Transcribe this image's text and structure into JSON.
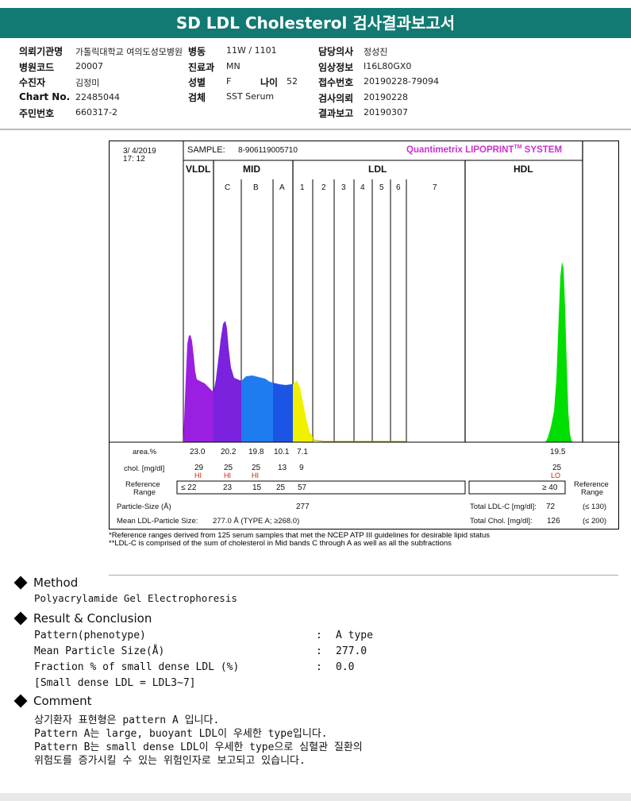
{
  "title": "SD LDL Cholesterol 검사결과보고서",
  "info": {
    "r1": {
      "l1": "의뢰기관명",
      "v1": "가톨릭대학교 여의도성모병원",
      "l2": "병동",
      "v2": "11W / 1101",
      "l3": "담당의사",
      "v3": "정성진"
    },
    "r2": {
      "l1": "병원코드",
      "v1": "20007",
      "l2": "진료과",
      "v2": "MN",
      "l3": "임상정보",
      "v3": "I16L80GX0"
    },
    "r3": {
      "l1": "수진자",
      "v1": "김정미",
      "l2": "성별",
      "v2": "F",
      "l2b": "나이",
      "v2b": "52",
      "l3": "접수번호",
      "v3": "20190228-79094"
    },
    "r4": {
      "l1": "Chart No.",
      "v1": "22485044",
      "l2": "검체",
      "v2": "SST Serum",
      "l3": "검사의뢰",
      "v3": "20190228"
    },
    "r5": {
      "l1": "주민번호",
      "v1": "660317-2",
      "l3": "결과보고",
      "v3": "20190307"
    }
  },
  "report": {
    "date": "3/  4/2019",
    "time": "17: 12",
    "sample_label": "SAMPLE:",
    "sample_id": "8-906119005710",
    "system_name": "Quantimetrix LIPOPRINT",
    "system_tm": "TM",
    "system_suffix": " SYSTEM",
    "accent_color": "#cc33cc",
    "groups": {
      "vldl": "VLDL",
      "mid": "MID",
      "ldl": "LDL",
      "hdl": "HDL"
    },
    "mid_bands": [
      "C",
      "B",
      "A"
    ],
    "ldl_bands": [
      "1",
      "2",
      "3",
      "4",
      "5",
      "6",
      "7"
    ],
    "area_label": "area.%",
    "area_values": {
      "vldl": "23.0",
      "c": "20.2",
      "b": "19.8",
      "a": "10.1",
      "l1": "7.1",
      "hdl": "19.5"
    },
    "chol_label": "chol. [mg/dl]",
    "chol_values": {
      "vldl": "29",
      "c": "25",
      "b": "25",
      "a": "13",
      "l1": "9",
      "hdl": "25"
    },
    "flags": {
      "vldl": "HI",
      "c": "HI",
      "b": "HI",
      "hdl": "LO"
    },
    "ref_label_1": "Reference",
    "ref_label_2": "Range",
    "ref_values": {
      "vldl": "≤  22",
      "c": "23",
      "b": "15",
      "a": "25",
      "l1": "57",
      "hdl": "≥ 40"
    },
    "particle_size_label": "Particle-Size (Å)",
    "particle_size_value": "277",
    "mean_ldl_label": "Mean LDL-Particle Size:",
    "mean_ldl_value": "277.0 Å   (TYPE A; ≥268.0)",
    "total_ldl_label": "Total LDL-C [mg/dl]:",
    "total_ldl_value": "72",
    "total_ldl_ref": "(≤ 130)",
    "total_chol_label": "Total Chol. [mg/dl]:",
    "total_chol_value": "126",
    "total_chol_ref": "(≤ 200)",
    "colors": {
      "vldl": "#9b1fe0",
      "c": "#7a22dd",
      "b": "#1f7bf0",
      "a": "#1c55e6",
      "l1": "#f0f000",
      "hdl": "#00dd00",
      "flag": "#cc2200"
    }
  },
  "footnotes": [
    "*Reference ranges derived from 125 serum samples that met the NCEP ATP III guidelines for desirable lipid status",
    "**LDL-C is comprised of the sum of cholesterol in Mid bands C through A as well as all the subfractions"
  ],
  "method": {
    "heading": "Method",
    "text": "Polyacrylamide Gel Electrophoresis"
  },
  "result": {
    "heading": "Result & Conclusion",
    "rows": [
      {
        "label": "Pattern(phenotype)",
        "sep": ":",
        "value": "A type"
      },
      {
        "label": "Mean Particle Size(Å)",
        "sep": ":",
        "value": "277.0"
      },
      {
        "label": "Fraction % of small dense LDL (%)",
        "sep": ":",
        "value": "0.0"
      }
    ],
    "note": "[Small dense LDL = LDL3~7]"
  },
  "comment": {
    "heading": "Comment",
    "lines": [
      "상기환자 표현형은 pattern A 입니다.",
      "Pattern A는 large, buoyant LDL이 우세한 type입니다.",
      "Pattern B는 small dense LDL이 우세한 type으로 심혈관 질환의",
      "위험도를 증가시킬 수 있는 위험인자로 보고되고 있습니다."
    ]
  }
}
